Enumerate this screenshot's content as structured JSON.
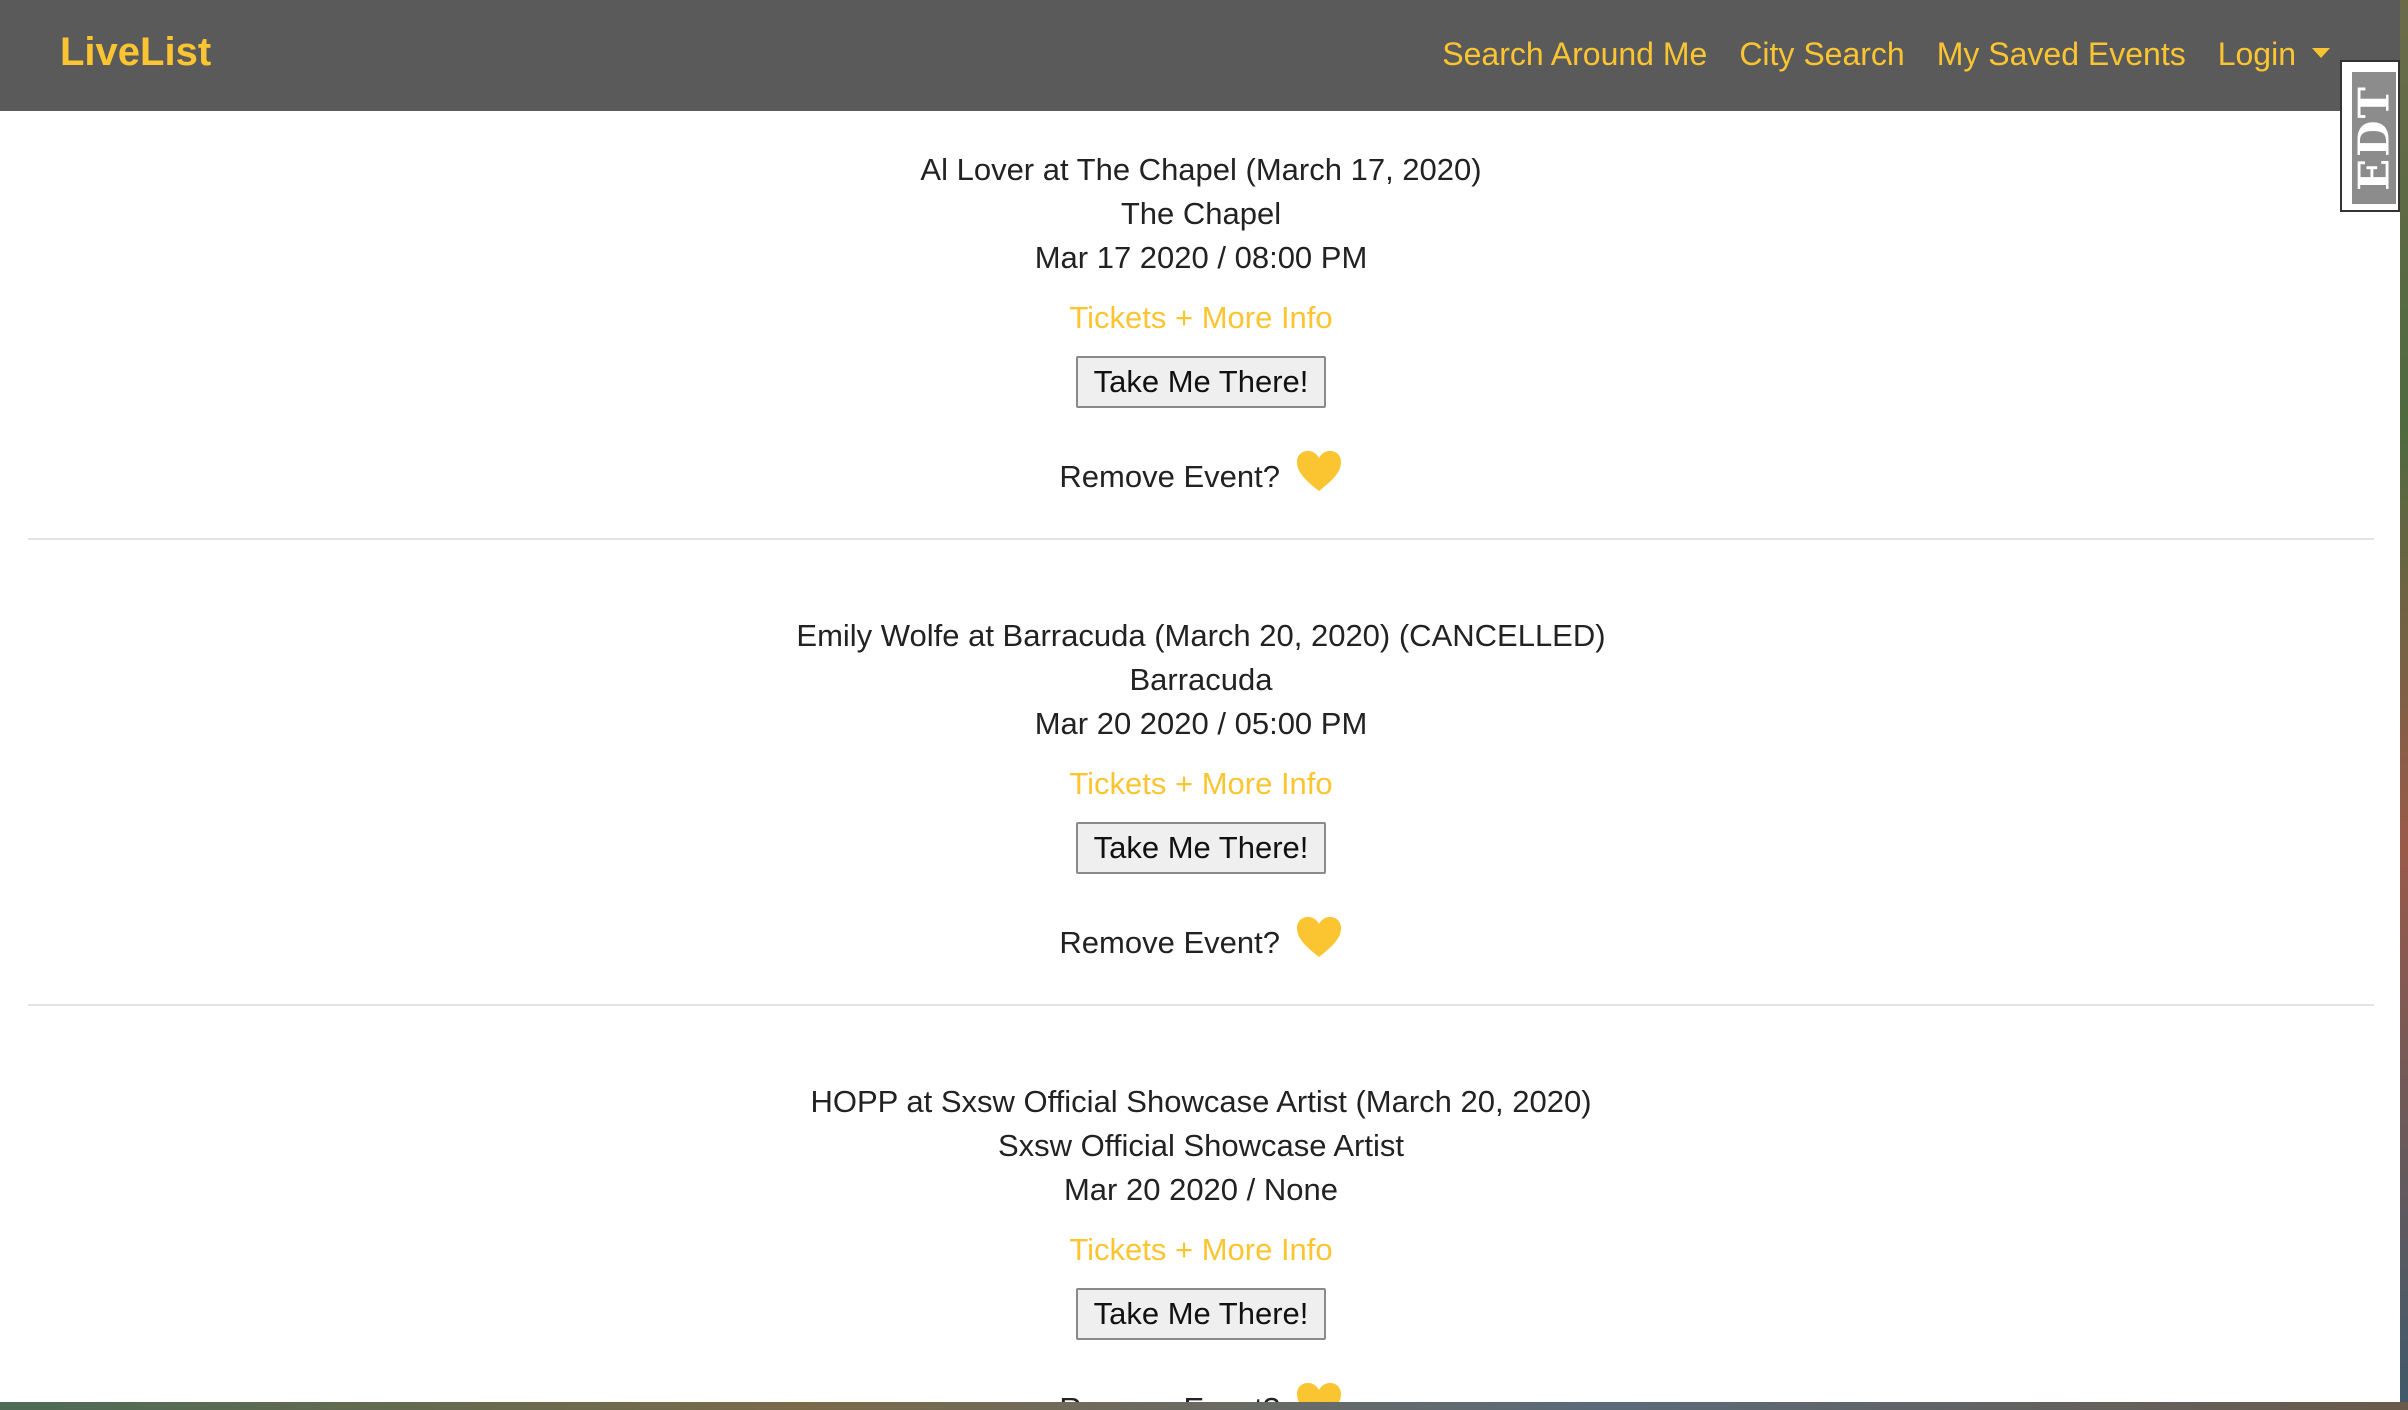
{
  "navbar": {
    "brand": "LiveList",
    "links": [
      "Search Around Me",
      "City Search",
      "My Saved Events",
      "Login"
    ]
  },
  "events": [
    {
      "title": "Al Lover at The Chapel (March 17, 2020)",
      "venue": "The Chapel",
      "datetime": "Mar 17 2020 / 08:00 PM",
      "tickets_label": "Tickets + More Info",
      "take_me_label": "Take Me There!",
      "remove_label": "Remove Event?"
    },
    {
      "title": "Emily Wolfe at Barracuda (March 20, 2020) (CANCELLED)",
      "venue": "Barracuda",
      "datetime": "Mar 20 2020 / 05:00 PM",
      "tickets_label": "Tickets + More Info",
      "take_me_label": "Take Me There!",
      "remove_label": "Remove Event?"
    },
    {
      "title": "HOPP at Sxsw Official Showcase Artist (March 20, 2020)",
      "venue": "Sxsw Official Showcase Artist",
      "datetime": "Mar 20 2020 / None",
      "tickets_label": "Tickets + More Info",
      "take_me_label": "Take Me There!",
      "remove_label": "Remove Event?"
    }
  ],
  "widget": {
    "label": "EDT"
  },
  "icons": {
    "heart": "heart-icon",
    "caret": "chevron-down-icon"
  },
  "colors": {
    "accent": "#fbc531",
    "navbar": "#5a5a5a",
    "text": "#222222"
  }
}
